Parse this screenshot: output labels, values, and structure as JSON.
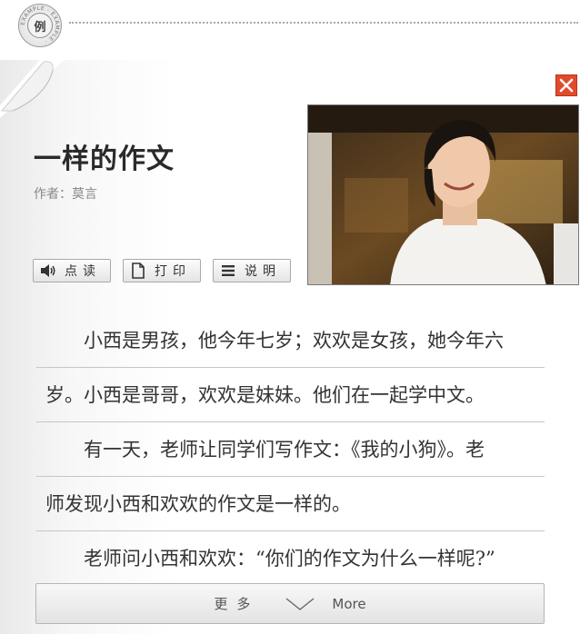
{
  "stamp": {
    "char": "例",
    "ring_text": "EXAMPLE"
  },
  "article": {
    "title": "一样的作文",
    "author": "作者：莫言"
  },
  "toolbar": {
    "read_label": "点读",
    "print_label": "打印",
    "notes_label": "说明"
  },
  "paragraphs": [
    {
      "text": "小西是男孩，他今年七岁；欢欢是女孩，她今年六",
      "indent": true
    },
    {
      "text": "岁。小西是哥哥，欢欢是妹妹。他们在一起学中文。",
      "indent": false
    },
    {
      "text": "有一天，老师让同学们写作文：《我的小狗》。老",
      "indent": true
    },
    {
      "text": "师发现小西和欢欢的作文是一样的。",
      "indent": false
    },
    {
      "text": "老师问小西和欢欢：“你们的作文为什么一样呢?”",
      "indent": true
    }
  ],
  "more": {
    "label_cn": "更多",
    "label_en": "More"
  },
  "colors": {
    "close_red": "#e24a2c"
  },
  "icons": [
    "speaker-icon",
    "document-icon",
    "list-icon",
    "close-icon",
    "chevron-down-icon"
  ]
}
